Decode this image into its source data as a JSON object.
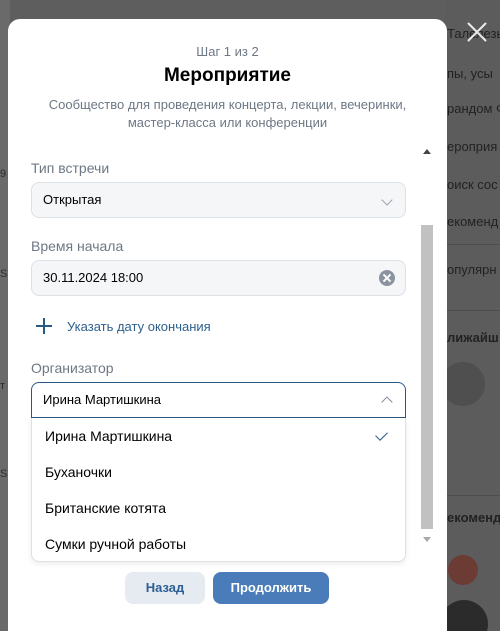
{
  "background": {
    "right_texts": [
      "Талелезы",
      "пы, усы",
      "рандом Ф",
      "ероприя",
      "оиск сос",
      "екоменд",
      "опулярн",
      "лижайш",
      "екоменд"
    ],
    "left_letters": [
      "9",
      "S",
      "S",
      "т"
    ]
  },
  "modal": {
    "step": "Шаг 1 из 2",
    "title": "Мероприятие",
    "subtitle": "Сообщество для проведения концерта, лекции, вечеринки, мастер-класса или конференции"
  },
  "form": {
    "meeting_type": {
      "label": "Тип встречи",
      "value": "Открытая"
    },
    "start_time": {
      "label": "Время начала",
      "value": "30.11.2024   18:00"
    },
    "add_end_date": "Указать дату окончания",
    "organizer": {
      "label": "Организатор",
      "value": "Ирина Мартишкина",
      "options": [
        "Ирина Мартишкина",
        "Буханочки",
        "Британские котята",
        "Сумки ручной работы"
      ],
      "selected_index": 0
    }
  },
  "buttons": {
    "back": "Назад",
    "next": "Продолжить"
  },
  "colors": {
    "accent": "#2a5885",
    "primary_button": "#4a7cb9",
    "secondary_button": "#e5ebf1"
  }
}
